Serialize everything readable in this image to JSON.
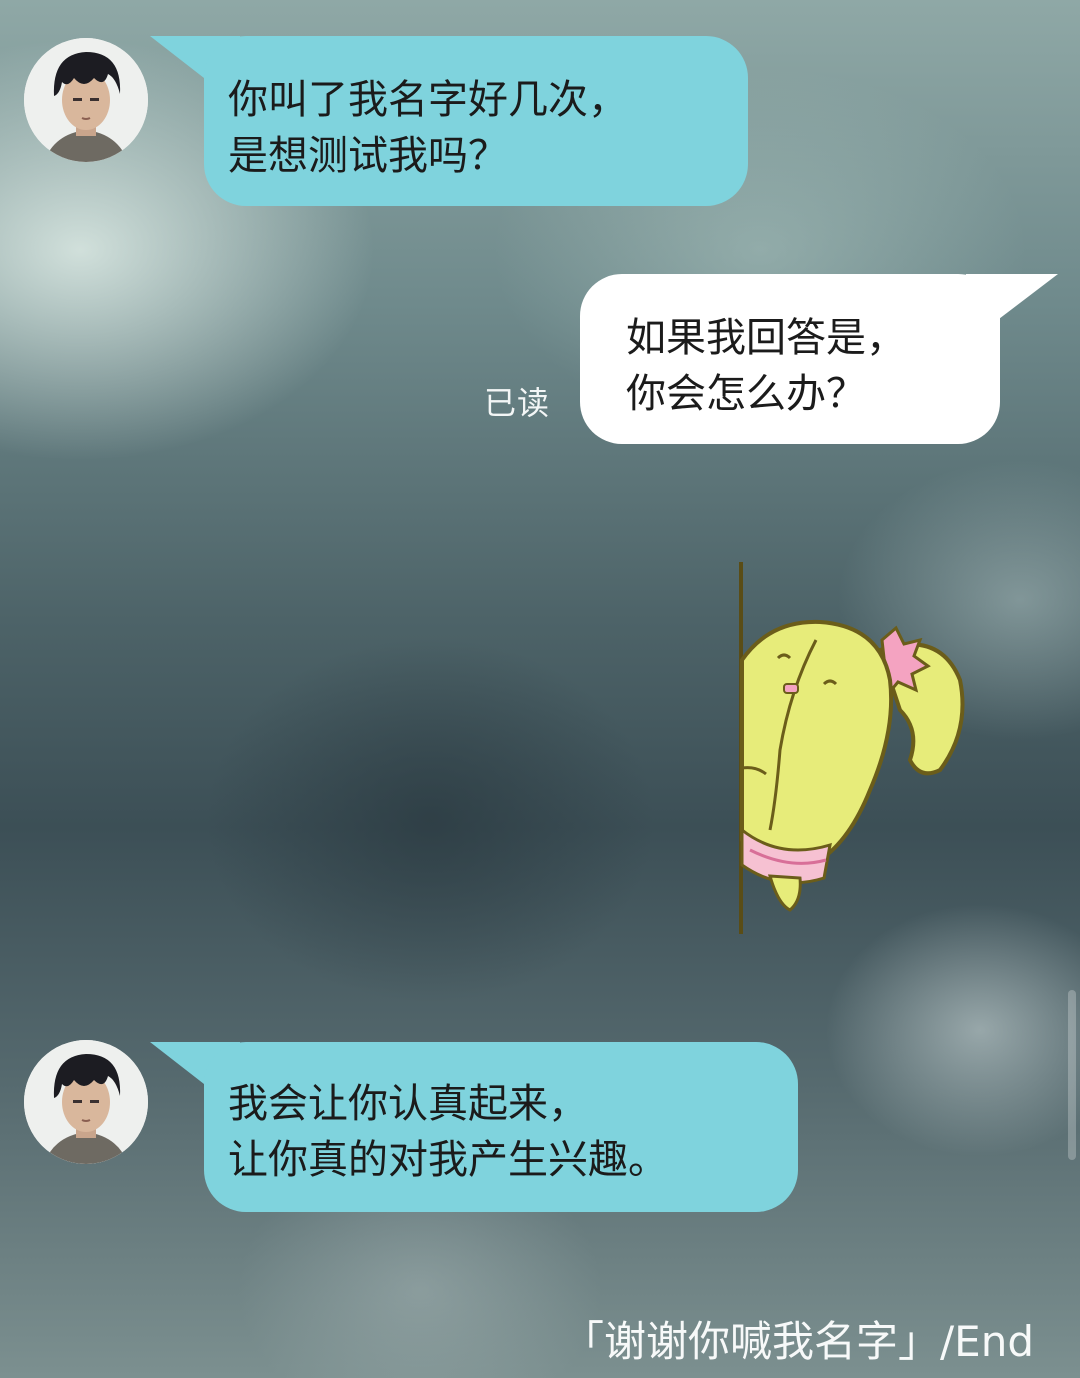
{
  "messages": [
    {
      "sender": "other",
      "lines": [
        "你叫了我名字好几次，",
        "是想测试我吗？"
      ]
    },
    {
      "sender": "self",
      "status": "已读",
      "lines": [
        "如果我回答是，",
        "你会怎么办？"
      ]
    },
    {
      "sender": "other",
      "type": "sticker",
      "sticker_icon": "peeking-cactus-sticker-icon"
    },
    {
      "sender": "other",
      "lines": [
        "我会让你认真起来，",
        "让你真的对我产生兴趣。"
      ]
    }
  ],
  "caption": "「谢谢你喊我名字」/End",
  "colors": {
    "incoming_bubble": "#7fd3dd",
    "outgoing_bubble": "#ffffff",
    "read_receipt_text": "#f3f6f6"
  }
}
